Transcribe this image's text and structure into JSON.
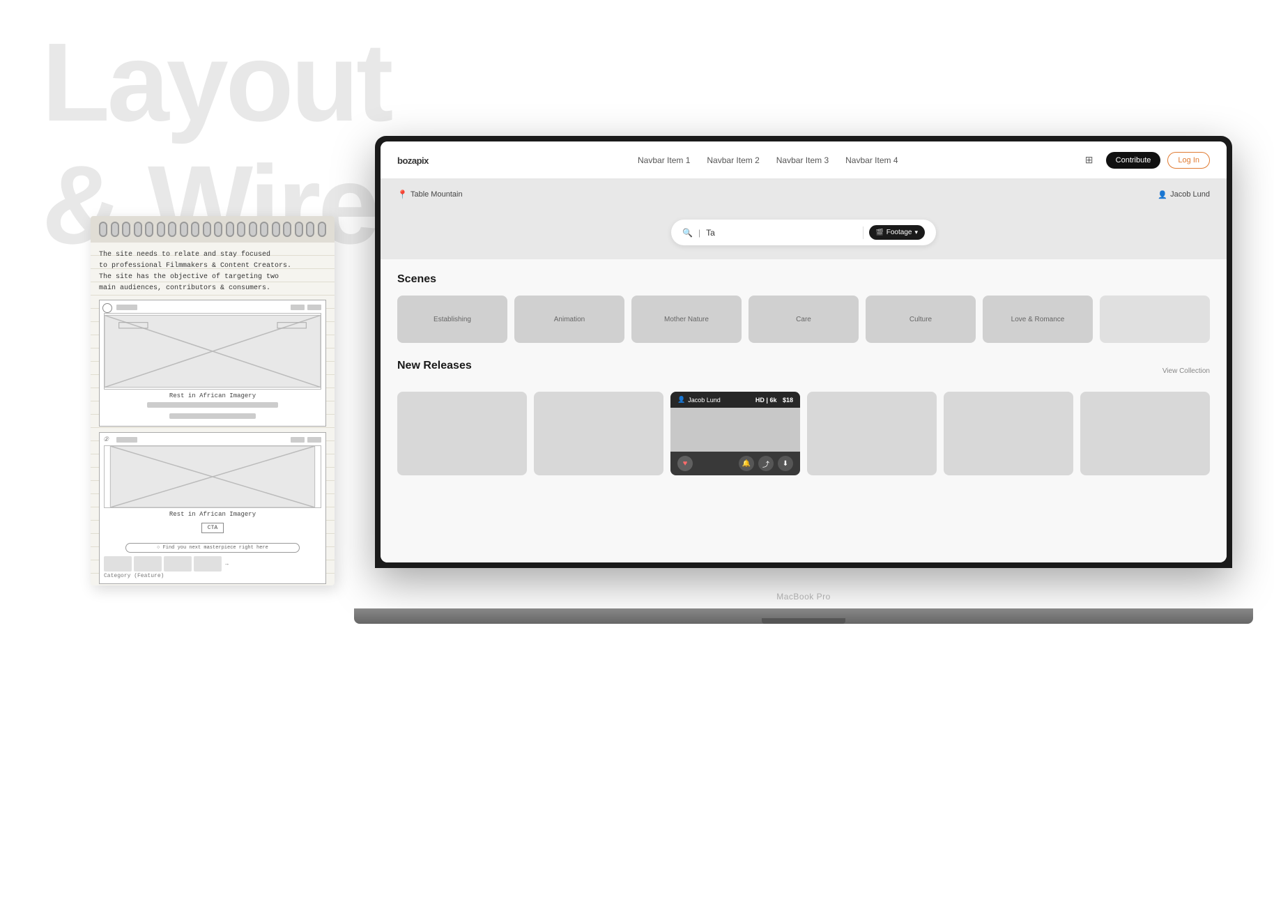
{
  "background": {
    "title_line1": "Layout",
    "title_line2": "& Wireframe"
  },
  "notebook": {
    "text_line1": "The site needs to relate and stay focused",
    "text_line2": "to professional Filmmakers & Content Creators.",
    "text_line3": "The site has the objective of targeting two",
    "text_line4": "main audiences, contributors & consumers.",
    "sketch1": {
      "label": "Rest in African Imagery"
    },
    "sketch2": {
      "label": "Rest in African Imagery",
      "cta": "CTA",
      "search": "Find you next masterpiece right here",
      "category_label": "Category (Feature)"
    }
  },
  "website": {
    "navbar": {
      "logo": "bozapix",
      "items": [
        "Navbar Item 1",
        "Navbar Item 2",
        "Navbar Item 3",
        "Navbar Item 4"
      ],
      "contribute_label": "Contribute",
      "login_label": "Log In"
    },
    "location_bar": {
      "location": "Table Mountain",
      "user": "Jacob Lund"
    },
    "search": {
      "placeholder": "Ta",
      "footage_label": "Footage"
    },
    "scenes": {
      "title": "Scenes",
      "items": [
        "Establishing",
        "Animation",
        "Mother Nature",
        "Care",
        "Culture",
        "Love & Romance"
      ]
    },
    "releases": {
      "title": "New Releases",
      "view_collection": "View Collection",
      "featured_card": {
        "author": "Jacob Lund",
        "resolution": "HD | 6k",
        "price": "$18"
      }
    }
  },
  "laptop": {
    "model": "MacBook Pro"
  }
}
